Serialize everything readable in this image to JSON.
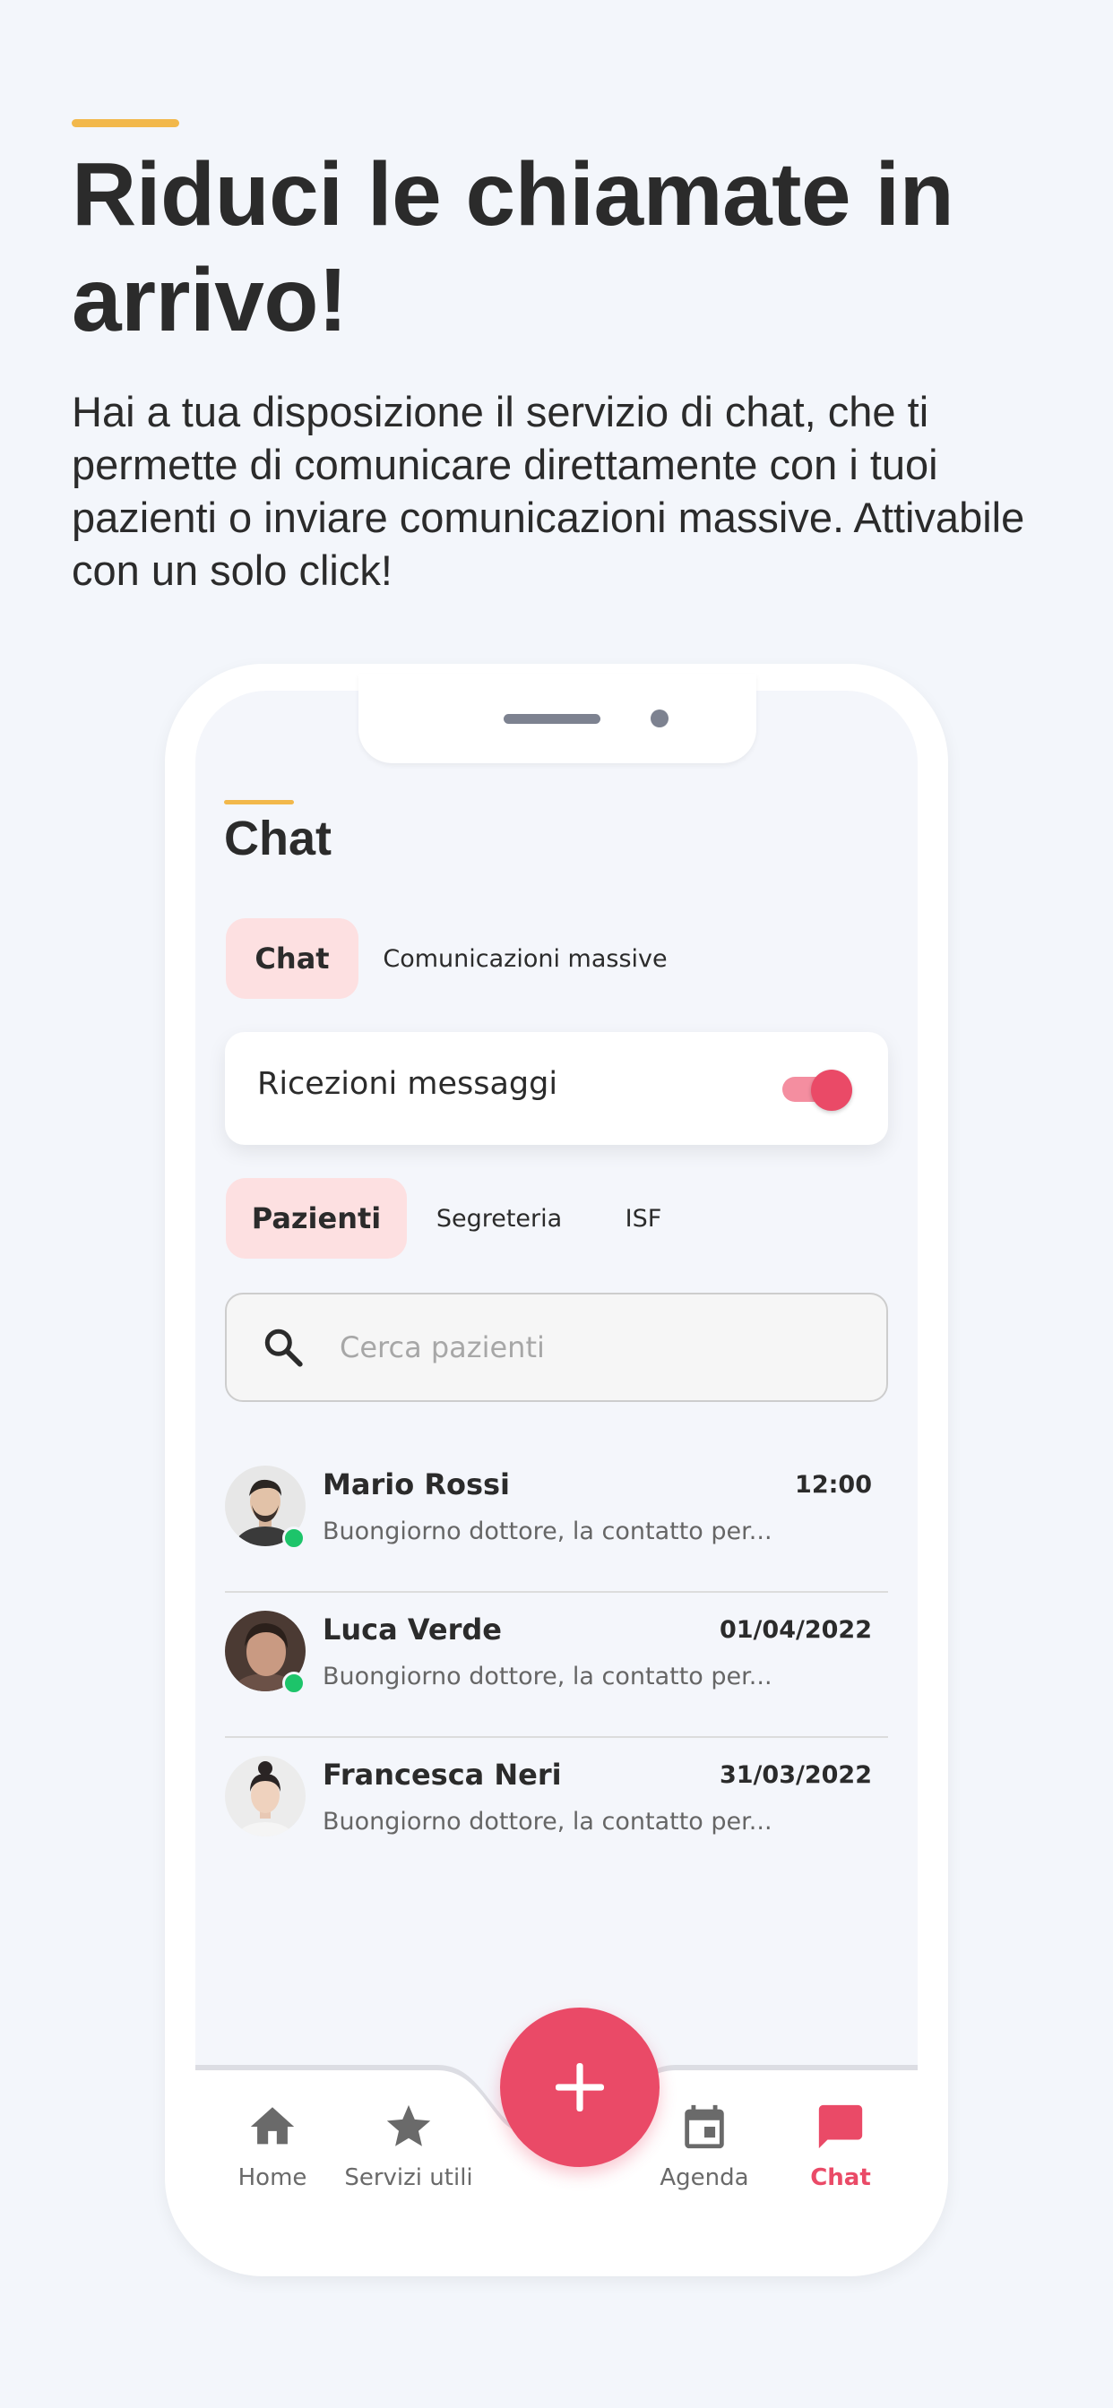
{
  "hero": {
    "title": "Riduci le chiamate in arrivo!",
    "description": "Hai a tua disposizione il servizio di chat, che ti permette di comunicare direttamente con i tuoi pazienti o inviare comunicazioni massive. Attivabile con un solo click!"
  },
  "app": {
    "page_title": "Chat",
    "top_tabs": [
      {
        "label": "Chat",
        "active": true
      },
      {
        "label": "Comunicazioni massive",
        "active": false
      }
    ],
    "receive_toggle": {
      "label": "Ricezioni messaggi",
      "on": true
    },
    "filter_tabs": [
      {
        "label": "Pazienti",
        "active": true
      },
      {
        "label": "Segreteria",
        "active": false
      },
      {
        "label": "ISF",
        "active": false
      }
    ],
    "search": {
      "placeholder": "Cerca pazienti",
      "value": ""
    },
    "conversations": [
      {
        "name": "Mario Rossi",
        "time": "12:00",
        "preview": "Buongiorno dottore, la contatto per...",
        "online": true
      },
      {
        "name": "Luca Verde",
        "time": "01/04/2022",
        "preview": "Buongiorno dottore, la contatto per...",
        "online": true
      },
      {
        "name": "Francesca Neri",
        "time": "31/03/2022",
        "preview": "Buongiorno dottore, la contatto per...",
        "online": false
      }
    ],
    "bottom_nav": [
      {
        "label": "Home",
        "icon": "home-icon",
        "active": false
      },
      {
        "label": "Servizi utili",
        "icon": "star-icon",
        "active": false
      },
      {
        "label": "Agenda",
        "icon": "calendar-icon",
        "active": false
      },
      {
        "label": "Chat",
        "icon": "chat-icon",
        "active": true
      }
    ],
    "fab_icon": "plus-icon"
  },
  "colors": {
    "accent_yellow": "#f2b84b",
    "brand_red": "#ea4a67",
    "tab_active_bg": "#fde0e1",
    "online_green": "#1dc46a",
    "background": "#f3f6fb"
  }
}
